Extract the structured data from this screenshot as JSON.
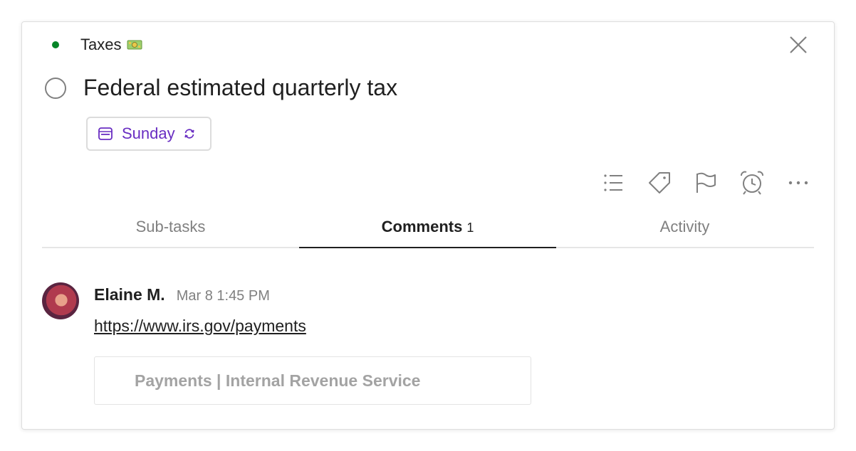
{
  "task": {
    "project": "Taxes",
    "project_color": "#058527",
    "project_emoji_icon": "money-banknote-icon",
    "title": "Federal estimated quarterly tax",
    "due_label": "Sunday",
    "due_color": "#692ec2",
    "recurring": true
  },
  "toolbar": {
    "items": [
      "subtasks-list-icon",
      "label-tag-icon",
      "priority-flag-icon",
      "reminder-alarm-icon",
      "more-options-icon"
    ]
  },
  "tabs": [
    {
      "label": "Sub-tasks",
      "count": ""
    },
    {
      "label": "Comments",
      "count": "1",
      "active": true
    },
    {
      "label": "Activity",
      "count": ""
    }
  ],
  "comment": {
    "author": "Elaine M.",
    "timestamp": "Mar 8 1:45 PM",
    "link": "https://www.irs.gov/payments",
    "preview_title": "Payments | Internal Revenue Service"
  }
}
